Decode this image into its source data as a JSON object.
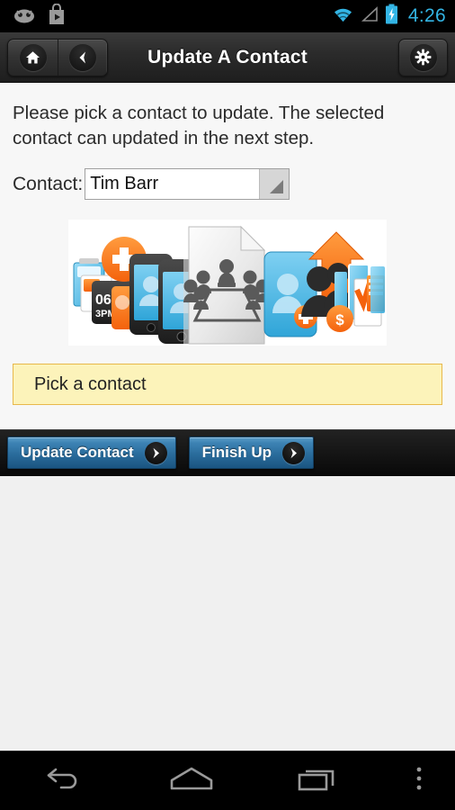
{
  "statusbar": {
    "left_icons": [
      {
        "name": "android-robot-icon"
      },
      {
        "name": "play-store-icon"
      }
    ],
    "right_icons": [
      {
        "name": "wifi-icon"
      },
      {
        "name": "cell-signal-icon"
      },
      {
        "name": "battery-charging-icon"
      }
    ],
    "time": "4:26",
    "accent_color": "#33b5e5"
  },
  "actionbar": {
    "title": "Update A Contact",
    "home_icon": "home-icon",
    "back_icon": "chevron-left-icon",
    "settings_icon": "gear-icon"
  },
  "main": {
    "intro_text": "Please pick a contact to update. The selected contact can updated in the next step.",
    "contact_field": {
      "label": "Contact:",
      "value": "Tim Barr",
      "placeholder": "Tim Barr",
      "dropdown_icon": "dropdown-triangle-icon"
    },
    "banner": {
      "alt": "collage of contact management illustrations",
      "center_icon": "meeting-document-icon"
    },
    "notice": {
      "text": "Pick a contact",
      "background_color": "#fcf3ba",
      "border_color": "#e8b84b"
    }
  },
  "buttonbar": {
    "buttons": [
      {
        "label": "Update Contact",
        "icon": "chevron-right-icon"
      },
      {
        "label": "Finish Up",
        "icon": "chevron-right-icon"
      }
    ],
    "accent_color": "#2a6c9c"
  },
  "navbar": {
    "back_icon": "back-arrow-icon",
    "home_icon": "home-outline-icon",
    "recents_icon": "recents-icon",
    "menu_icon": "overflow-menu-icon"
  }
}
